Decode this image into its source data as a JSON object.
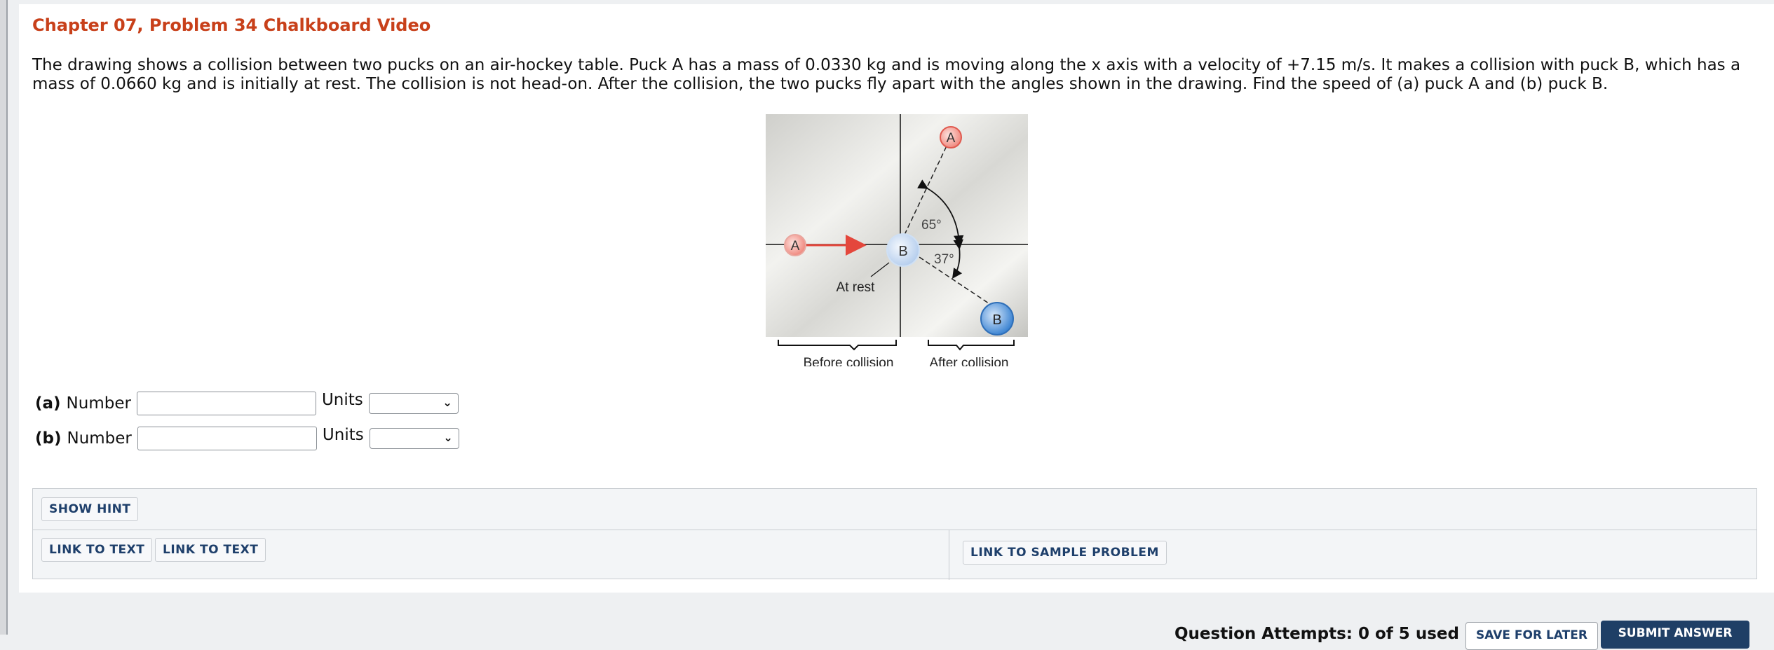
{
  "header": {
    "title": "Chapter 07, Problem 34 Chalkboard Video"
  },
  "problem": {
    "text": "The drawing shows a collision between two pucks on an air-hockey table. Puck A has a mass of 0.0330 kg and is moving along the x axis with a velocity of +7.15 m/s. It makes a collision with puck B, which has a mass of 0.0660 kg and is initially at rest. The collision is not head-on. After the collision, the two pucks fly apart with the angles shown in the drawing. Find the speed of (a) puck A and (b) puck B."
  },
  "figure": {
    "puck_a_label": "A",
    "puck_b_label": "B",
    "angle_a_label": "65°",
    "angle_b_label": "37°",
    "at_rest_label": "At rest",
    "before_label": "Before collision",
    "after_label": "After collision"
  },
  "answers": [
    {
      "part": "(a)",
      "number_label": "Number",
      "number_value": "",
      "units_label": "Units",
      "units_value": ""
    },
    {
      "part": "(b)",
      "number_label": "Number",
      "number_value": "",
      "units_label": "Units",
      "units_value": ""
    }
  ],
  "tools": {
    "show_hint": "SHOW HINT",
    "link_to_text_1": "LINK TO TEXT",
    "link_to_text_2": "LINK TO TEXT",
    "link_to_sample_problem": "LINK TO SAMPLE PROBLEM"
  },
  "footer": {
    "attempts": "Question Attempts: 0 of 5 used",
    "save_for_later": "SAVE FOR LATER",
    "submit_answer": "SUBMIT ANSWER"
  },
  "colors": {
    "title": "#c8401a",
    "puck_a": "#f08a80",
    "puck_b_before": "#c9ddf3",
    "puck_b_after": "#4a8fd6",
    "arrow": "#e4473c",
    "submit_bg": "#1f3f66"
  }
}
